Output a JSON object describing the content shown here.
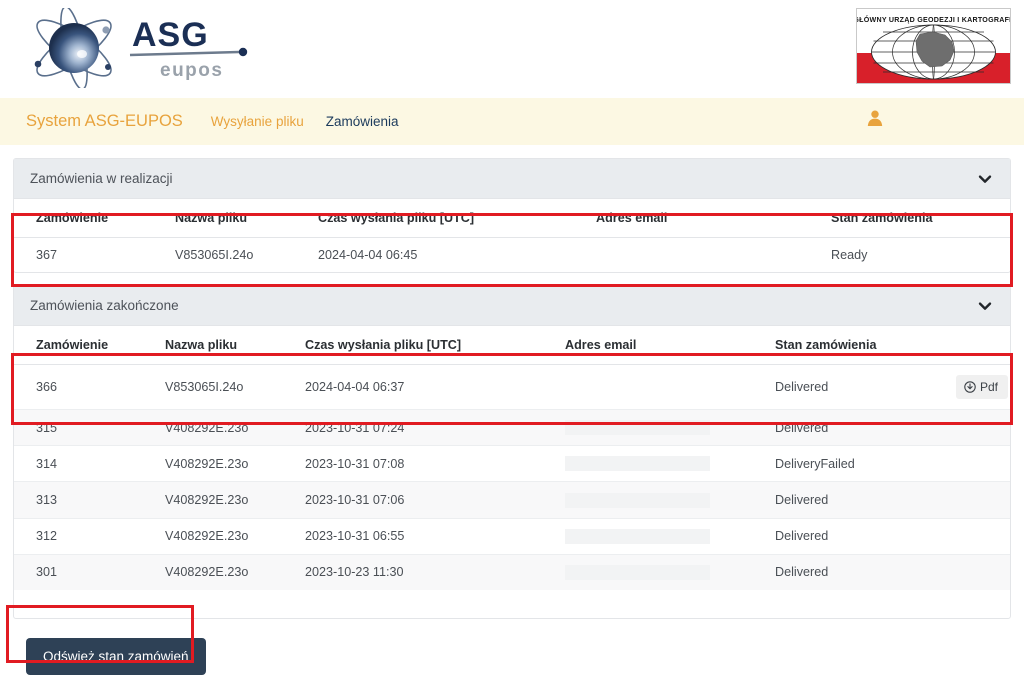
{
  "header": {
    "asg_logo_alt": "ASG eupos",
    "asg_logo_main": "ASG",
    "asg_logo_sub": "eupos",
    "gugik_logo_text": "GŁÓWNY URZĄD GEODEZJI I KARTOGRAFII"
  },
  "navbar": {
    "brand": "System ASG-EUPOS",
    "links": [
      {
        "label": "Wysyłanie pliku",
        "active": false
      },
      {
        "label": "Zamówienia",
        "active": true
      }
    ],
    "user_icon": "user-icon",
    "brand_color": "#e8a33d",
    "active_link_color": "#1b3a5c",
    "background_color": "#fcf8e3"
  },
  "panels": [
    {
      "title": "Zamówienia w realizacji",
      "collapse_icon": "chevron-down-icon",
      "columns": [
        "Zamówienie",
        "Nazwa pliku",
        "Czas wysłania pliku [UTC]",
        "Adres email",
        "Stan zamówienia"
      ],
      "rows": [
        {
          "order": "367",
          "file_name": "V853065I.24o",
          "sent_time": "2024-04-04 06:45",
          "email": "",
          "email_redacted": false,
          "status": "Ready",
          "action": null
        }
      ]
    },
    {
      "title": "Zamówienia zakończone",
      "collapse_icon": "chevron-down-icon",
      "columns": [
        "Zamówienie",
        "Nazwa pliku",
        "Czas wysłania pliku [UTC]",
        "Adres email",
        "Stan zamówienia",
        ""
      ],
      "rows": [
        {
          "order": "366",
          "file_name": "V853065I.24o",
          "sent_time": "2024-04-04 06:37",
          "email": "",
          "email_redacted": false,
          "status": "Delivered",
          "action": "Pdf"
        },
        {
          "order": "315",
          "file_name": "V408292E.23o",
          "sent_time": "2023-10-31 07:24",
          "email": "",
          "email_redacted": true,
          "status": "Delivered",
          "action": null
        },
        {
          "order": "314",
          "file_name": "V408292E.23o",
          "sent_time": "2023-10-31 07:08",
          "email": "",
          "email_redacted": true,
          "status": "DeliveryFailed",
          "action": null
        },
        {
          "order": "313",
          "file_name": "V408292E.23o",
          "sent_time": "2023-10-31 07:06",
          "email": "",
          "email_redacted": true,
          "status": "Delivered",
          "action": null
        },
        {
          "order": "312",
          "file_name": "V408292E.23o",
          "sent_time": "2023-10-31 06:55",
          "email": "",
          "email_redacted": true,
          "status": "Delivered",
          "action": null
        },
        {
          "order": "301",
          "file_name": "V408292E.23o",
          "sent_time": "2023-10-23 11:30",
          "email": "",
          "email_redacted": true,
          "status": "Delivered",
          "action": null
        }
      ]
    }
  ],
  "footer": {
    "refresh_label": "Odśwież stan zamówień",
    "refresh_bg_color": "#2e4156"
  },
  "annotations": {
    "color": "#e11b22",
    "boxes": [
      "orders-in-progress-table",
      "completed-orders-first-row",
      "refresh-orders-button"
    ]
  }
}
